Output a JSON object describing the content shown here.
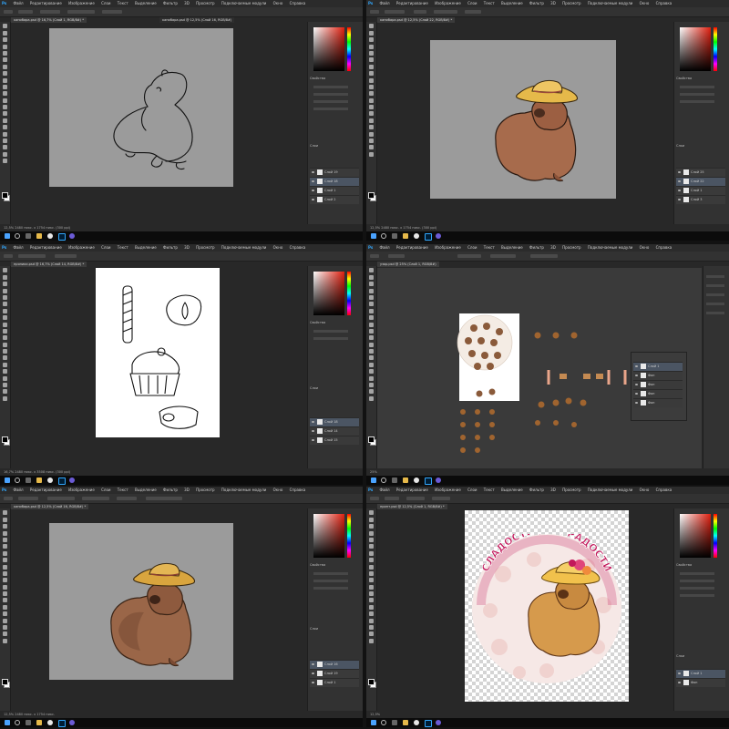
{
  "colors": {
    "panel_bg": "#323232",
    "workspace_bg": "#282828",
    "canvas_gray": "#9b9b9b",
    "accent_blue": "#31a8ff",
    "capybara_brown": "#a76b4c",
    "hat_yellow": "#e6b94a"
  },
  "app": {
    "name": "Adobe Photoshop",
    "menu": [
      "Файл",
      "Редактирование",
      "Изображение",
      "Слои",
      "Текст",
      "Выделение",
      "Фильтр",
      "3D",
      "Просмотр",
      "Подключаемые модули",
      "Окно",
      "Справка"
    ]
  },
  "screens": [
    {
      "doc_title": "капибара.psd @ 16,7% (Слой 1, RGB/8#) *",
      "doc_title_2": "капибара.psd @ 12,5% (Слой 16, RGB/8#)",
      "status": "12,5%   2480 пикс. x 1754 пикс. (300 ppi)",
      "layers": [
        "Слой 19",
        "Слой 18",
        "Слой 1",
        "Слой 2"
      ]
    },
    {
      "doc_title": "капибара.psd @ 12,5% (Слой 22, RGB/8#) *",
      "status": "12,5%   2480 пикс. x 1754 пикс. (300 ppi)",
      "layers": [
        "Слой 25",
        "Слой 22",
        "Слой 1",
        "Слой 3"
      ]
    },
    {
      "doc_title": "пряники.psd @ 16,7% (Слой 14, RGB/8#) *",
      "status": "16,7%   2480 пикс. x 3508 пикс. (300 ppi)",
      "layers": [
        "Слой 18",
        "Слой 14",
        "Слой 15"
      ]
    },
    {
      "doc_title": "узор.psd @ 25% (Слой 1, RGB/8#)",
      "status": "25%",
      "layers": [
        "Слой 1",
        "Фон",
        "Фон",
        "Фон",
        "Фон"
      ]
    },
    {
      "doc_title": "капибара.psd @ 12,5% (Слой 16, RGB/8#) *",
      "status": "12,5%   2480 пикс. x 1754 пикс.",
      "layers": [
        "Слой 16",
        "Слой 19",
        "Слой 1"
      ]
    },
    {
      "doc_title": "принт.psd @ 12,5% (Слой 1, RGB/8#) *",
      "status": "12,5%",
      "layers": [
        "Слой 1",
        "Фон"
      ],
      "print_text": "СЛАДОСТИ ДЛЯ РАДОСТИ"
    }
  ],
  "icons": [
    "windows-start-icon",
    "search-icon",
    "task-view-icon",
    "file-explorer-icon",
    "yandex-browser-icon",
    "photoshop-icon",
    "app-icon"
  ]
}
